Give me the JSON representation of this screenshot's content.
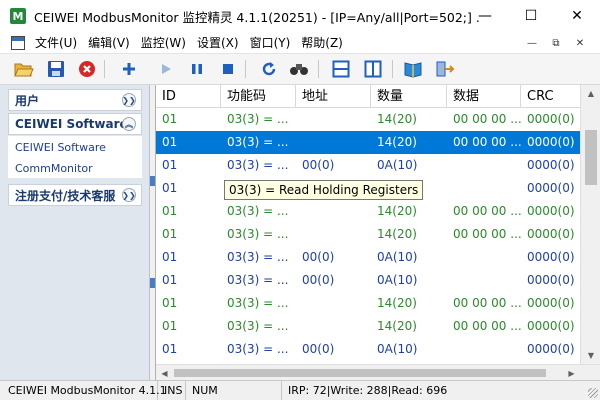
{
  "window": {
    "icon_letter": "M",
    "title": "CEIWEI ModbusMonitor 监控精灵 4.1.1(20251) - [IP=Any/all|Port=502;] ...",
    "minimize_glyph": "—",
    "maximize_glyph": "☐",
    "close_glyph": "✕"
  },
  "menu": {
    "items": [
      "文件(U)",
      "编辑(V)",
      "监控(W)",
      "设置(X)",
      "窗口(Y)",
      "帮助(Z)"
    ],
    "mdi_minimize": "—",
    "mdi_restore": "⧉",
    "mdi_close": "✕"
  },
  "toolbar": {
    "icons": [
      "open-folder-icon",
      "save-icon",
      "stop-red-icon",
      "add-icon",
      "play-icon",
      "pause-icon",
      "stop-icon",
      "refresh-icon",
      "find-icon",
      "split-horizontal-icon",
      "split-vertical-icon",
      "book-icon",
      "exit-icon"
    ],
    "colors": {
      "blue": "#1f5fbf",
      "red": "#d62828",
      "disabled": "#9bb7dc"
    }
  },
  "sidebar": {
    "groups": [
      {
        "title": "用户"
      },
      {
        "title": "CEIWEI Software",
        "links": [
          "CEIWEI Software",
          "CommMonitor"
        ]
      },
      {
        "title": "注册支付/技术客服"
      }
    ]
  },
  "table": {
    "columns": [
      "ID",
      "功能码",
      "地址",
      "数量",
      "数据",
      "CRC"
    ],
    "rows": [
      {
        "id": "01",
        "func": "03(3) = ...",
        "addr": "",
        "qty": "14(20)",
        "data": "00 00 00 ...",
        "crc": "0000(0)",
        "color": "green",
        "selected": false
      },
      {
        "id": "01",
        "func": "03(3) = ...",
        "addr": "",
        "qty": "14(20)",
        "data": "00 00 00 ...",
        "crc": "0000(0)",
        "color": "blue",
        "selected": true
      },
      {
        "id": "01",
        "func": "03(3) = ...",
        "addr": "00(0)",
        "qty": "0A(10)",
        "data": "",
        "crc": "0000(0)",
        "color": "blue",
        "selected": false
      },
      {
        "id": "01",
        "func": "03(3) = ...",
        "addr": "00(0)",
        "qty": "0A(10)",
        "data": "",
        "crc": "0000(0)",
        "color": "blue",
        "selected": false
      },
      {
        "id": "01",
        "func": "03(3) = ...",
        "addr": "",
        "qty": "14(20)",
        "data": "00 00 00 ...",
        "crc": "0000(0)",
        "color": "green",
        "selected": false
      },
      {
        "id": "01",
        "func": "03(3) = ...",
        "addr": "",
        "qty": "14(20)",
        "data": "00 00 00 ...",
        "crc": "0000(0)",
        "color": "green",
        "selected": false
      },
      {
        "id": "01",
        "func": "03(3) = ...",
        "addr": "00(0)",
        "qty": "0A(10)",
        "data": "",
        "crc": "0000(0)",
        "color": "blue",
        "selected": false
      },
      {
        "id": "01",
        "func": "03(3) = ...",
        "addr": "00(0)",
        "qty": "0A(10)",
        "data": "",
        "crc": "0000(0)",
        "color": "blue",
        "selected": false
      },
      {
        "id": "01",
        "func": "03(3) = ...",
        "addr": "",
        "qty": "14(20)",
        "data": "00 00 00 ...",
        "crc": "0000(0)",
        "color": "green",
        "selected": false
      },
      {
        "id": "01",
        "func": "03(3) = ...",
        "addr": "",
        "qty": "14(20)",
        "data": "00 00 00 ...",
        "crc": "0000(0)",
        "color": "green",
        "selected": false
      },
      {
        "id": "01",
        "func": "03(3) = ...",
        "addr": "00(0)",
        "qty": "0A(10)",
        "data": "",
        "crc": "0000(0)",
        "color": "blue",
        "selected": false
      }
    ],
    "tooltip": "03(3) = Read Holding Registers"
  },
  "statusbar": {
    "app": "CEIWEI ModbusMonitor 4.1.1",
    "ins": "INS",
    "num": "NUM",
    "stats": "IRP: 72|Write: 288|Read: 696"
  }
}
